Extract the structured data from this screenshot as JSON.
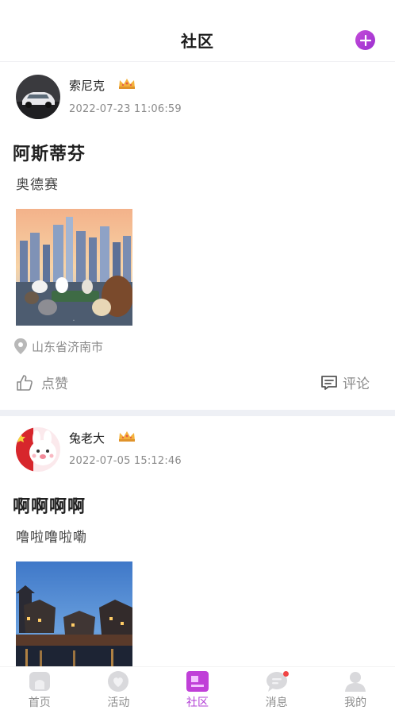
{
  "header": {
    "title": "社区",
    "add_icon": "plus-circle-icon",
    "accent": "#b23fd6"
  },
  "posts": [
    {
      "username": "索尼克",
      "badge_icon": "crown-icon",
      "time": "2022-07-23 11:06:59",
      "title": "阿斯蒂芬",
      "body": "奥德赛",
      "image": "pets-movie-poster",
      "location": "山东省济南市",
      "like_label": "点赞",
      "comment_label": "评论"
    },
    {
      "username": "兔老大",
      "badge_icon": "crown-icon",
      "time": "2022-07-05 15:12:46",
      "title": "啊啊啊啊",
      "body": "噜啦噜啦嘞",
      "image": "night-river-town"
    }
  ],
  "tabbar": {
    "items": [
      {
        "label": "首页",
        "icon": "home-icon"
      },
      {
        "label": "活动",
        "icon": "heart-icon"
      },
      {
        "label": "社区",
        "icon": "community-icon",
        "active": true
      },
      {
        "label": "消息",
        "icon": "message-icon",
        "badge": true
      },
      {
        "label": "我的",
        "icon": "profile-icon"
      }
    ]
  }
}
